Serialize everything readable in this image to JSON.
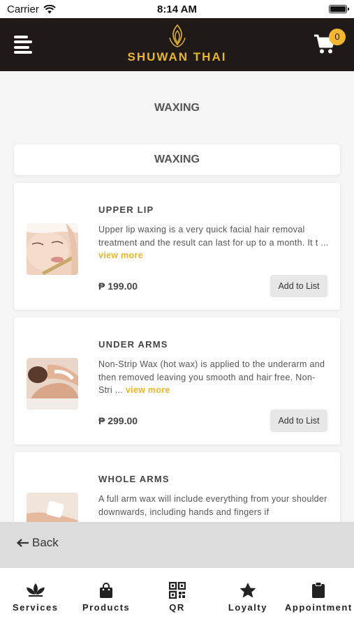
{
  "status_bar": {
    "carrier": "Carrier",
    "time": "8:14 AM"
  },
  "header": {
    "brand": "SHUWAN THAI",
    "cart_count": "0"
  },
  "page": {
    "title": "WAXING",
    "category": "WAXING"
  },
  "items": [
    {
      "name": "UPPER LIP",
      "description": "Upper lip waxing is a very quick facial hair removal treatment and the result can last for up to a month. It t ...",
      "view_more": "view more",
      "price": "₱ 199.00",
      "button": "Add to List"
    },
    {
      "name": "UNDER ARMS",
      "description": "Non-Strip Wax (hot wax) is applied to the underarm and then removed leaving you smooth and hair free. Non-Stri ...",
      "view_more": "view more",
      "price": "₱ 299.00",
      "button": "Add to List"
    },
    {
      "name": "WHOLE ARMS",
      "description": "A full arm wax will include everything from your shoulder downwards, including hands and fingers if"
    }
  ],
  "back": {
    "label": "Back"
  },
  "bottom_nav": [
    {
      "label": "Services",
      "icon": "lotus-icon"
    },
    {
      "label": "Products",
      "icon": "shopping-bag-icon"
    },
    {
      "label": "QR",
      "icon": "qr-code-icon"
    },
    {
      "label": "Loyalty",
      "icon": "star-icon"
    },
    {
      "label": "Appointment",
      "icon": "clipboard-icon"
    }
  ],
  "colors": {
    "accent": "#e8b62d",
    "header_bg": "#1f1a17",
    "badge": "#f3b731"
  }
}
